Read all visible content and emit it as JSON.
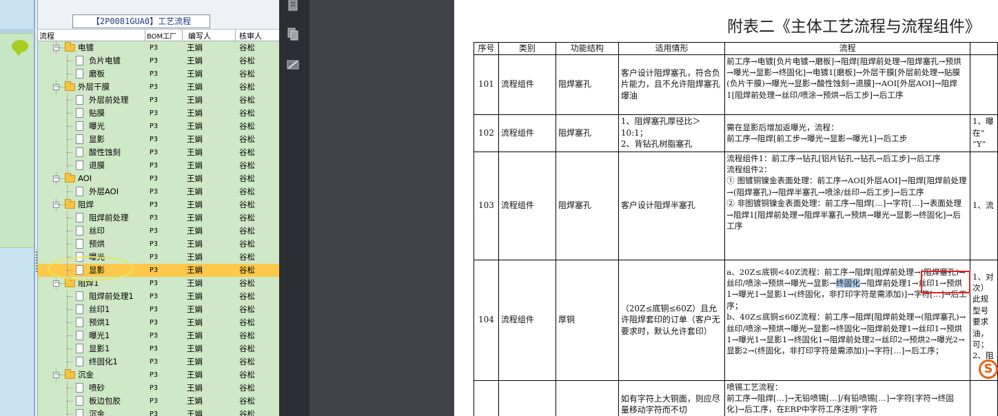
{
  "app": {
    "panel_title": "【2P0081GUA0】工艺流程",
    "columns": [
      "流程",
      "BOM工厂",
      "编写人",
      "核审人"
    ]
  },
  "tree": [
    {
      "label": "电镀",
      "type": "folder",
      "level": 1,
      "bom": "P3",
      "author": "王娟",
      "reviewer": "谷松"
    },
    {
      "label": "负片电镀",
      "type": "doc",
      "level": 2,
      "bom": "P3",
      "author": "王娟",
      "reviewer": "谷松"
    },
    {
      "label": "磨板",
      "type": "doc",
      "level": 2,
      "bom": "P3",
      "author": "王娟",
      "reviewer": "谷松"
    },
    {
      "label": "外层干膜",
      "type": "folder",
      "level": 1,
      "bom": "P3",
      "author": "王娟",
      "reviewer": "谷松"
    },
    {
      "label": "外层前处理",
      "type": "doc",
      "level": 2,
      "bom": "P3",
      "author": "王娟",
      "reviewer": "谷松"
    },
    {
      "label": "贴膜",
      "type": "doc",
      "level": 2,
      "bom": "P3",
      "author": "王娟",
      "reviewer": "谷松"
    },
    {
      "label": "曝光",
      "type": "doc",
      "level": 2,
      "bom": "P3",
      "author": "王娟",
      "reviewer": "谷松"
    },
    {
      "label": "显影",
      "type": "doc",
      "level": 2,
      "bom": "P3",
      "author": "王娟",
      "reviewer": "谷松"
    },
    {
      "label": "酸性蚀刻",
      "type": "doc",
      "level": 2,
      "bom": "P3",
      "author": "王娟",
      "reviewer": "谷松"
    },
    {
      "label": "退膜",
      "type": "doc",
      "level": 2,
      "bom": "P3",
      "author": "王娟",
      "reviewer": "谷松"
    },
    {
      "label": "AOI",
      "type": "folder",
      "level": 1,
      "bom": "P3",
      "author": "王娟",
      "reviewer": "谷松"
    },
    {
      "label": "外层AOI",
      "type": "doc",
      "level": 2,
      "bom": "P3",
      "author": "王娟",
      "reviewer": "谷松"
    },
    {
      "label": "阻焊",
      "type": "folder",
      "level": 1,
      "bom": "P3",
      "author": "王娟",
      "reviewer": "谷松"
    },
    {
      "label": "阻焊前处理",
      "type": "doc",
      "level": 2,
      "bom": "P3",
      "author": "王娟",
      "reviewer": "谷松"
    },
    {
      "label": "丝印",
      "type": "doc",
      "level": 2,
      "bom": "P3",
      "author": "王娟",
      "reviewer": "谷松"
    },
    {
      "label": "预烘",
      "type": "doc",
      "level": 2,
      "bom": "P3",
      "author": "王娟",
      "reviewer": "谷松"
    },
    {
      "label": "曝光",
      "type": "doc",
      "level": 2,
      "bom": "P3",
      "author": "王娟",
      "reviewer": "谷松"
    },
    {
      "label": "显影",
      "type": "doc",
      "level": 2,
      "bom": "P3",
      "author": "王娟",
      "reviewer": "谷松",
      "selected": true
    },
    {
      "label": "阻焊1",
      "type": "folder",
      "level": 1,
      "bom": "P3",
      "author": "王娟",
      "reviewer": "谷松"
    },
    {
      "label": "阻焊前处理1",
      "type": "doc",
      "level": 2,
      "bom": "P3",
      "author": "王娟",
      "reviewer": "谷松"
    },
    {
      "label": "丝印1",
      "type": "doc",
      "level": 2,
      "bom": "P3",
      "author": "王娟",
      "reviewer": "谷松"
    },
    {
      "label": "预烘1",
      "type": "doc",
      "level": 2,
      "bom": "P3",
      "author": "王娟",
      "reviewer": "谷松"
    },
    {
      "label": "曝光1",
      "type": "doc",
      "level": 2,
      "bom": "P3",
      "author": "王娟",
      "reviewer": "谷松"
    },
    {
      "label": "显影1",
      "type": "doc",
      "level": 2,
      "bom": "P3",
      "author": "王娟",
      "reviewer": "谷松"
    },
    {
      "label": "终固化1",
      "type": "doc",
      "level": 2,
      "bom": "P3",
      "author": "王娟",
      "reviewer": "谷松"
    },
    {
      "label": "沉金",
      "type": "folder",
      "level": 1,
      "bom": "P3",
      "author": "王娟",
      "reviewer": "谷松"
    },
    {
      "label": "喷砂",
      "type": "doc",
      "level": 2,
      "bom": "P3",
      "author": "王娟",
      "reviewer": "谷松"
    },
    {
      "label": "板边包胶",
      "type": "doc",
      "level": 2,
      "bom": "P3",
      "author": "王娟",
      "reviewer": "谷松"
    },
    {
      "label": "沉金",
      "type": "doc",
      "level": 2,
      "bom": "P3",
      "author": "王娟",
      "reviewer": "谷松"
    }
  ],
  "document": {
    "title": "附表二《主体工艺流程与流程组件》",
    "headers": [
      "序号",
      "类别",
      "功能结构",
      "适用情形",
      "流程",
      ""
    ],
    "rows": [
      {
        "no": "101",
        "type": "流程组件",
        "func": "阻焊塞孔",
        "case": "客户设计阻焊塞孔，符合负片能力，且不允许阻焊塞孔爆油",
        "flow": "前工序→电镀[负片电镀→磨板]→阻焊[阻焊前处理→阻焊塞孔→预烘→曝光→显影→终固化]→电镀1[磨板]→外层干膜[外层前处理→贴膜(负片干膜)→曝光→显影→酸性蚀刻→退膜]→AOI[外层AOI]→阻焊1[阻焊前处理→丝印/喷涂→预烘→后工步]→后工序",
        "note": ""
      },
      {
        "no": "102",
        "type": "流程组件",
        "func": "阻焊塞孔",
        "case": "1、阻焊塞孔厚径比＞10:1；\n2、背钻孔树脂塞孔",
        "flow": "需在显影后增加返曝光，流程：\n前工序→阻焊[前工步→曝光→显影→曝光1]→后工步",
        "note": "1、曝\n在“\n“Y”"
      },
      {
        "no": "103",
        "type": "流程组件",
        "func": "阻焊塞孔",
        "case": "客户设计阻焊半塞孔",
        "flow": "流程组件1：前工序→钻孔[铝片钻孔→钻孔→后工步]→后工序\n流程组件2：\n① 图镀铜镍金表面处理：前工序→AOI[外层AOI]→阻焊[阻焊前处理→(阻焊塞孔)→阻焊半塞孔→喷涂/丝印→后工步]→后工序\n② 非图镀铜镍金表面处理：前工序→阻焊[…]→字符[…]→表面处理→阻焊1[阻焊前处理→阻焊半塞孔→预烘→曝光→显影→终固化]→后工序",
        "note": "1、流"
      },
      {
        "no": "104",
        "type": "流程组件",
        "func": "厚铜",
        "case": "（20Z≤底铜≤60Z）且允许阻焊套印的订单（客户无要求时，默认允许套印）",
        "flow_a": "a、20Z≤底铜<40Z流程：前工序→阻焊[阻焊前处理→(阻焊塞孔)→丝印/喷涂→预烘→曝光→显影→",
        "flow_hl": "终固化",
        "flow_b": "→阻焊前处理1→丝印1→预烘1→曝光1→显影1→(终固化，非打印字符是需添加)]→字符[…]→后工序；\nb、40Z≤底铜≤60Z流程：前工序→阻焊[阻焊前处理→(阻焊塞孔)→丝印/喷涂→预烘→曝光→显影→终固化→阻焊前处理1→丝印1→预烘1→曝光1→显影1→终固化1→阻焊前处理2→丝印2→预烘2→曝光2→显影2→(终固化，非打印字符是需添加)]→字符[…]→后工序；",
        "note": "1、对\n次）\n此规\n型号\n要求\n油，\n可；\n2、阻"
      },
      {
        "no": "",
        "type": "",
        "func": "",
        "case": "如有字符上大铜面，则应尽量移动字符而不切",
        "flow": "喷锡工艺流程：\n前工序→阻焊[…]→无铅喷锡[…]/有铅喷锡[…]→字符[字符→终固化]→后工序，在ERP中字符工序注明“字符",
        "note": ""
      }
    ]
  },
  "icons": {
    "chat": "chat-bubble-icon",
    "side1": "page-icon",
    "side2": "copy-page-icon",
    "side3": "edit-sign-icon",
    "ime": "sogou-ime-icon"
  },
  "colors": {
    "selected_row": "#fcc94b",
    "tree_bg": "#cfe8c7",
    "highlight": "#b3d3ef",
    "red_box": "#e02020",
    "ellipse": "#e6e85a"
  }
}
